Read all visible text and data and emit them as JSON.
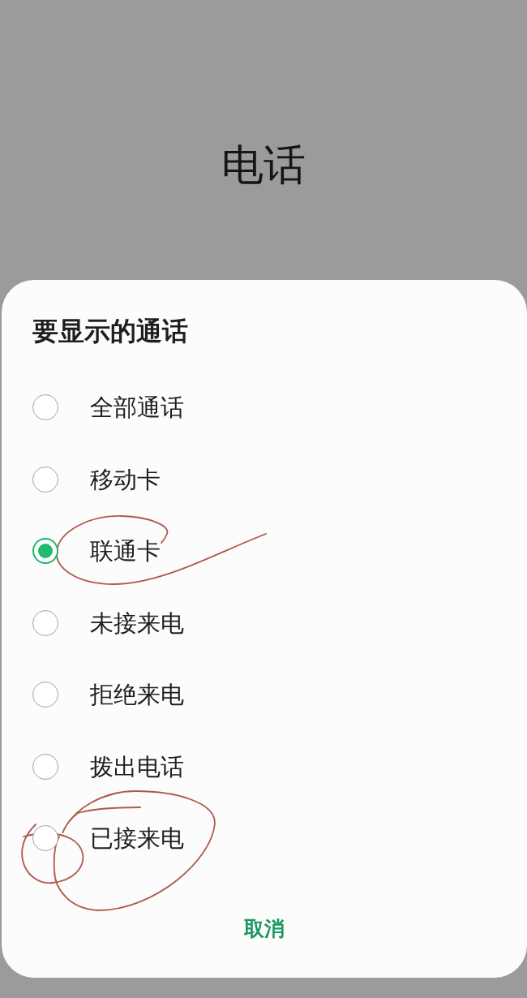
{
  "background_screen": {
    "title": "电话"
  },
  "dialog": {
    "title": "要显示的通话",
    "options": [
      {
        "label": "全部通话",
        "selected": false
      },
      {
        "label": "移动卡",
        "selected": false
      },
      {
        "label": "联通卡",
        "selected": true
      },
      {
        "label": "未接来电",
        "selected": false
      },
      {
        "label": "拒绝来电",
        "selected": false
      },
      {
        "label": "拨出电话",
        "selected": false
      },
      {
        "label": "已接来电",
        "selected": false
      }
    ],
    "buttons": [
      {
        "label": "取消"
      }
    ]
  }
}
